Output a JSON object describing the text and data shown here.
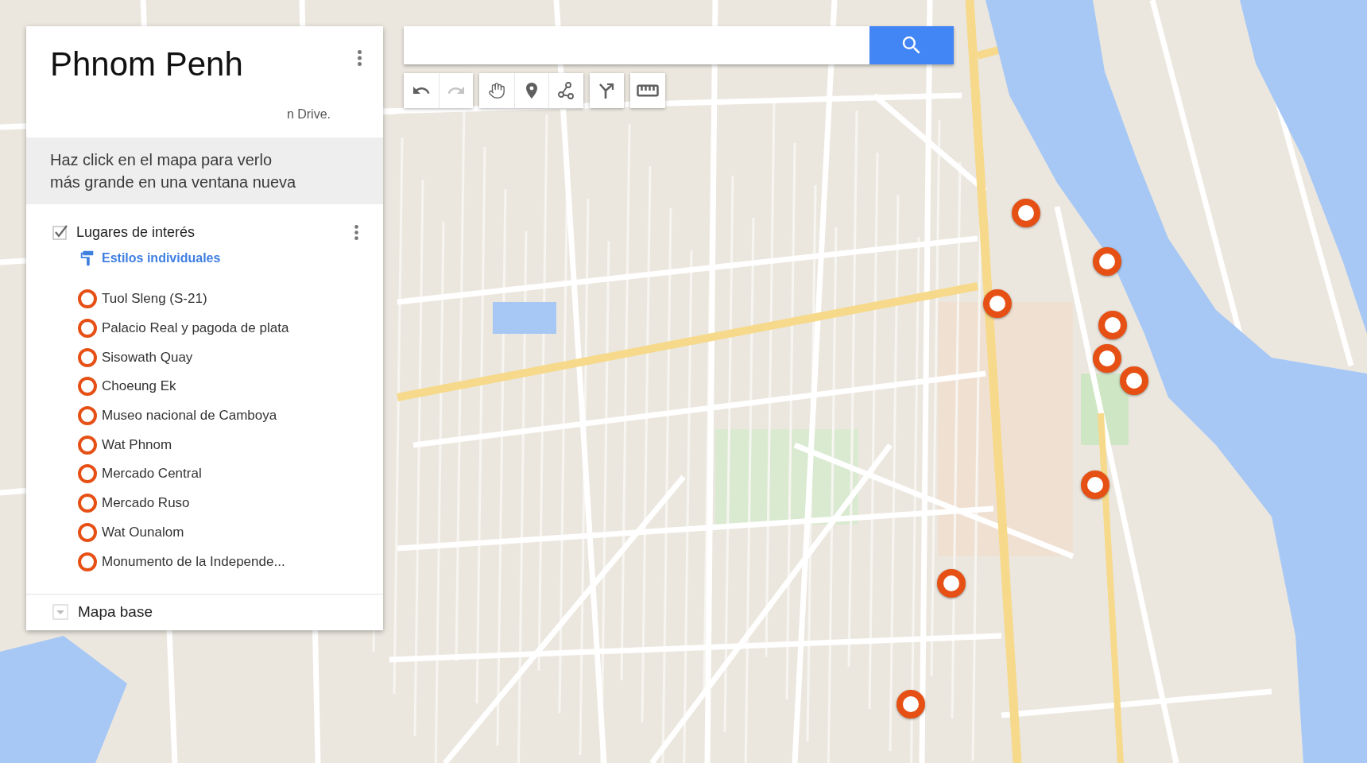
{
  "panel": {
    "title": "Phnom Penh",
    "note": "n Drive.",
    "banner": [
      "Haz click en el mapa para verlo",
      "más grande en una ventana nueva"
    ],
    "layers": [
      {
        "title": "Lugares de interés",
        "checked": true,
        "style_link": "Estilos individuales",
        "places": [
          {
            "name": "Tuol Sleng (S-21)"
          },
          {
            "name": "Palacio Real y pagoda de plata"
          },
          {
            "name": "Sisowath Quay"
          },
          {
            "name": "Choeung Ek"
          },
          {
            "name": "Museo nacional de Camboya"
          },
          {
            "name": "Wat Phnom"
          },
          {
            "name": "Mercado Central"
          },
          {
            "name": "Mercado Ruso"
          },
          {
            "name": "Wat Ounalom"
          },
          {
            "name": "Monumento de la Independe..."
          }
        ]
      }
    ],
    "base_map": {
      "title": "Mapa base",
      "expanded": false
    }
  },
  "toolbar": [
    {
      "tools": [
        {
          "kind": "undo",
          "disabled": false
        },
        {
          "kind": "redo",
          "disabled": true
        }
      ]
    },
    {
      "tools": [
        {
          "kind": "pan",
          "disabled": false
        },
        {
          "kind": "marker",
          "disabled": false
        },
        {
          "kind": "line",
          "disabled": false
        }
      ]
    },
    {
      "tools": [
        {
          "kind": "route",
          "disabled": false
        }
      ]
    },
    {
      "tools": [
        {
          "kind": "measure",
          "disabled": false
        }
      ]
    }
  ]
}
